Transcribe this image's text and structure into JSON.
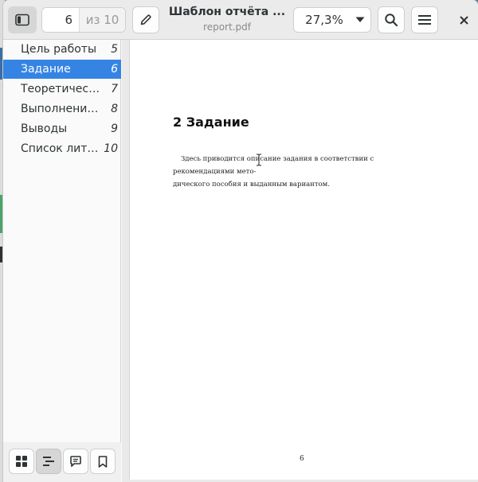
{
  "header": {
    "page_current": "6",
    "page_total_label": "из 10",
    "title": "Шаблон отчёта ...",
    "subtitle": "report.pdf",
    "zoom": "27,3%"
  },
  "sidebar": {
    "items": [
      {
        "label": "Цель работы",
        "page": "5",
        "selected": false
      },
      {
        "label": "Задание",
        "page": "6",
        "selected": true
      },
      {
        "label": "Теоретичес…",
        "page": "7",
        "selected": false
      },
      {
        "label": "Выполнение…",
        "page": "8",
        "selected": false
      },
      {
        "label": "Выводы",
        "page": "9",
        "selected": false
      },
      {
        "label": "Список лите…",
        "page": "10",
        "selected": false
      }
    ]
  },
  "document": {
    "section_number": "2",
    "section_title": "Задание",
    "section_heading": "2  Задание",
    "body_line1": "Здесь приводится описание задания в соответствии с рекомендациями мето-",
    "body_line2": "дического пособия и выданным вариантом.",
    "page_number": "6"
  },
  "colors": {
    "accent": "#3584e4",
    "header_bg": "#ebebeb",
    "sidebar_bg": "#fafafa"
  },
  "icons": {
    "sidebar_toggle": "sidebar-show-icon",
    "annotate": "pencil-icon",
    "zoom_dropdown": "chevron-down-icon",
    "search": "search-icon",
    "menu": "hamburger-menu-icon",
    "close": "close-icon",
    "view_thumbnails": "grid-icon",
    "view_outline": "outline-icon",
    "view_annotations": "comment-icon",
    "view_bookmarks": "bookmark-icon"
  }
}
